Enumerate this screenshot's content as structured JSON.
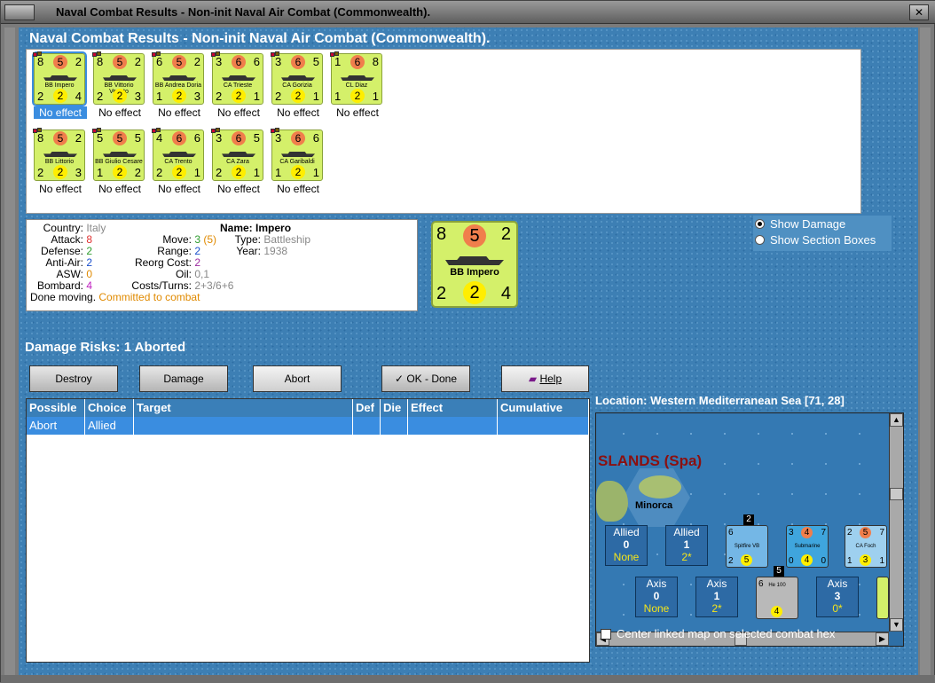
{
  "window": {
    "title": "Naval Combat Results - Non-init Naval Air Combat (Commonwealth)."
  },
  "heading": "Naval Combat Results - Non-init Naval Air Combat (Commonwealth).",
  "units": [
    {
      "tl": "8",
      "tc": "5",
      "tr": "2",
      "bl": "2",
      "bc": "2",
      "br": "4",
      "name": "BB Impero",
      "effect": "No effect",
      "selected": true
    },
    {
      "tl": "8",
      "tc": "5",
      "tr": "2",
      "bl": "2",
      "bc": "2",
      "br": "3",
      "name": "BB Vittorio Veneto",
      "effect": "No effect"
    },
    {
      "tl": "6",
      "tc": "5",
      "tr": "2",
      "bl": "1",
      "bc": "2",
      "br": "3",
      "name": "BB Andrea Doria",
      "effect": "No effect"
    },
    {
      "tl": "3",
      "tc": "6",
      "tr": "6",
      "bl": "2",
      "bc": "2",
      "br": "1",
      "name": "CA Trieste",
      "effect": "No effect"
    },
    {
      "tl": "3",
      "tc": "6",
      "tr": "5",
      "bl": "2",
      "bc": "2",
      "br": "1",
      "name": "CA Gorizia",
      "effect": "No effect"
    },
    {
      "tl": "1",
      "tc": "6",
      "tr": "8",
      "bl": "1",
      "bc": "2",
      "br": "1",
      "name": "CL Diaz",
      "effect": "No effect"
    },
    {
      "tl": "8",
      "tc": "5",
      "tr": "2",
      "bl": "2",
      "bc": "2",
      "br": "3",
      "name": "BB Littorio",
      "effect": "No effect"
    },
    {
      "tl": "5",
      "tc": "5",
      "tr": "5",
      "bl": "1",
      "bc": "2",
      "br": "2",
      "name": "BB Giulio Cesare",
      "effect": "No effect"
    },
    {
      "tl": "4",
      "tc": "6",
      "tr": "6",
      "bl": "2",
      "bc": "2",
      "br": "1",
      "name": "CA Trento",
      "effect": "No effect"
    },
    {
      "tl": "3",
      "tc": "6",
      "tr": "5",
      "bl": "2",
      "bc": "2",
      "br": "1",
      "name": "CA Zara",
      "effect": "No effect"
    },
    {
      "tl": "3",
      "tc": "6",
      "tr": "6",
      "bl": "1",
      "bc": "2",
      "br": "1",
      "name": "CA Garibaldi",
      "effect": "No effect"
    }
  ],
  "info": {
    "country_label": "Country:",
    "country": "Italy",
    "attack_label": "Attack:",
    "attack": "8",
    "defense_label": "Defense:",
    "defense": "2",
    "antiair_label": "Anti-Air:",
    "antiair": "2",
    "asw_label": "ASW:",
    "asw": "0",
    "bombard_label": "Bombard:",
    "bombard": "4",
    "move_label": "Move:",
    "move": "3",
    "move_paren": "(5)",
    "range_label": "Range:",
    "range": "2",
    "reorg_label": "Reorg Cost:",
    "reorg": "2",
    "oil_label": "Oil:",
    "oil": "0,1",
    "costs_label": "Costs/Turns:",
    "costs": "2+3/6+6",
    "name_label": "Name:",
    "name": "Impero",
    "type_label": "Type:",
    "type": "Battleship",
    "year_label": "Year:",
    "year": "1938",
    "status_label": "Done moving.",
    "status": "Committed to combat"
  },
  "big_counter": {
    "tl": "8",
    "tc": "5",
    "tr": "2",
    "bl": "2",
    "bc": "2",
    "br": "4",
    "name": "BB Impero"
  },
  "radios": [
    {
      "label": "Show Damage",
      "checked": true
    },
    {
      "label": "Show Section Boxes",
      "checked": false
    }
  ],
  "damage_risks": "Damage Risks:  1 Aborted",
  "buttons": {
    "destroy": "Destroy",
    "damage": "Damage",
    "abort": "Abort",
    "ok": "OK - Done",
    "help": "Help"
  },
  "table": {
    "headers": [
      "Possible",
      "Choice",
      "Target",
      "Def",
      "Die",
      "Effect",
      "Cumulative"
    ],
    "rows": [
      [
        "Abort",
        "Allied",
        "",
        "",
        "",
        "",
        ""
      ]
    ]
  },
  "location": "Location:  Western Mediterranean Sea [71, 28]",
  "map": {
    "region_label": "SLANDS (Spa)",
    "minorca": "Minorca",
    "allied_boxes": [
      {
        "label": "Allied",
        "value": "0",
        "sub": "None"
      },
      {
        "label": "Allied",
        "value": "1",
        "sub": "2*"
      }
    ],
    "axis_boxes": [
      {
        "label": "Axis",
        "value": "0",
        "sub": "None"
      },
      {
        "label": "Axis",
        "value": "1",
        "sub": "2*"
      },
      {
        "label": "Axis",
        "value": "3",
        "sub": "0*"
      }
    ],
    "counters": [
      {
        "name": "Spitfire VB",
        "tl": "6",
        "bl": "2",
        "bc": "5",
        "badge": "2"
      },
      {
        "name": "Submarine",
        "tl": "3",
        "tc": "4",
        "tr": "7",
        "bl": "0",
        "bc": "4",
        "br": "0"
      },
      {
        "name": "CA Foch",
        "tl": "2",
        "tc": "5",
        "tr": "7",
        "bl": "1",
        "bc": "3",
        "br": "1"
      },
      {
        "name": "He 100",
        "tl": "6",
        "bc": "4",
        "badge": "5"
      }
    ]
  },
  "center_checkbox": "Center linked map on selected combat hex",
  "colors": {
    "accent": "#3a8de0",
    "counter": "#d4f06a",
    "sea": "#3d7fb4"
  }
}
